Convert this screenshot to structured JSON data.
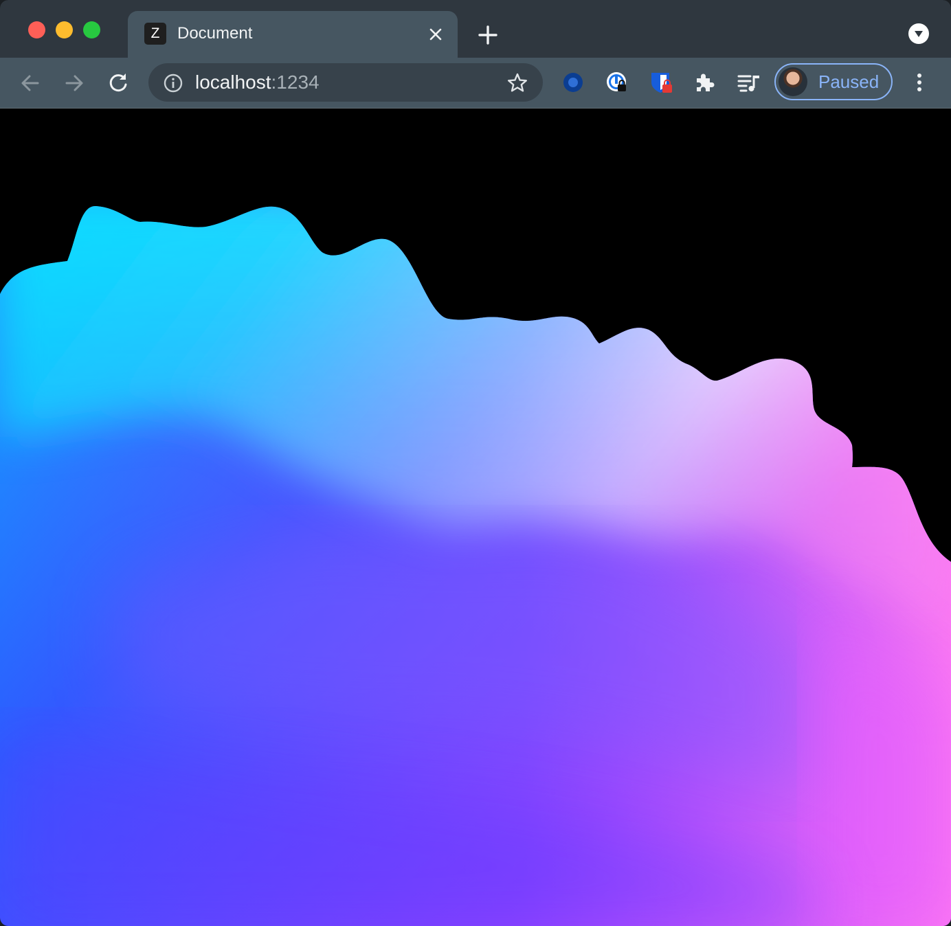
{
  "window": {
    "traffic_lights": [
      "close",
      "minimize",
      "zoom"
    ]
  },
  "tab": {
    "favicon_letter": "Z",
    "title": "Document",
    "close_icon": "close-icon"
  },
  "toolbar": {
    "back_icon": "arrow-left-icon",
    "forward_icon": "arrow-right-icon",
    "reload_icon": "reload-icon",
    "omnibox": {
      "host": "localhost",
      "port": ":1234",
      "info_icon": "info-icon",
      "star_icon": "star-icon"
    },
    "extensions": [
      "circle-extension-icon",
      "password-manager-icon",
      "shield-extension-icon",
      "puzzle-icon",
      "media-queue-icon"
    ],
    "profile": {
      "label": "Paused"
    },
    "menu_icon": "more-vert-icon"
  },
  "colors": {
    "titlebar": "#2f373f",
    "toolbar": "#465661",
    "profile_accent": "#8ab4f8",
    "page_background": "#000000",
    "gradient_cyan": "#00f0ff",
    "gradient_blue": "#2a5bff",
    "gradient_violet": "#6a3dff",
    "gradient_pink": "#ff8af0",
    "gradient_white": "#ffffff"
  }
}
